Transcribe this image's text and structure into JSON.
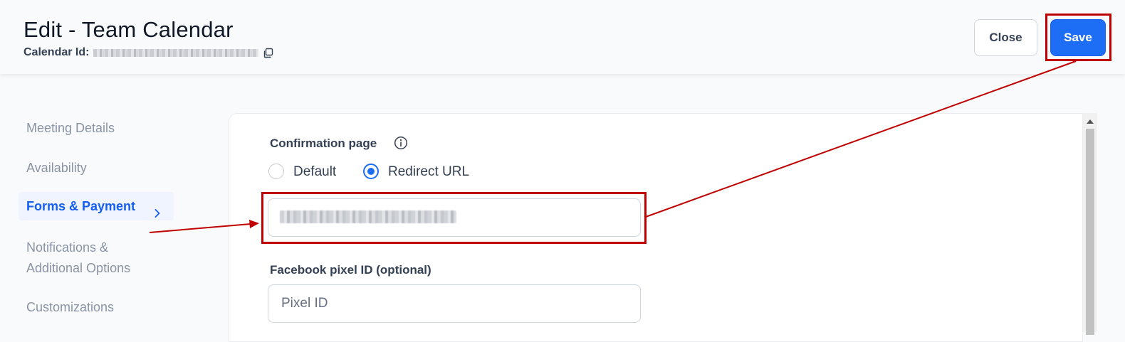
{
  "header": {
    "title": "Edit - Team Calendar",
    "calendar_id_label": "Calendar Id:",
    "close_label": "Close",
    "save_label": "Save"
  },
  "sidebar": {
    "items": [
      {
        "label": "Meeting Details",
        "active": false
      },
      {
        "label": "Availability",
        "active": false
      },
      {
        "label": "Forms & Payment",
        "active": true
      },
      {
        "label": "Notifications & Additional Options",
        "active": false
      },
      {
        "label": "Customizations",
        "active": false
      }
    ]
  },
  "form": {
    "confirmation_page_label": "Confirmation page",
    "options": [
      {
        "label": "Default",
        "checked": false
      },
      {
        "label": "Redirect URL",
        "checked": true
      }
    ],
    "facebook_pixel_label": "Facebook pixel ID (optional)",
    "pixel_placeholder": "Pixel ID"
  },
  "colors": {
    "accent": "#1d6ef5",
    "annotation": "#c00000",
    "active_nav_bg": "#eff4ff"
  }
}
